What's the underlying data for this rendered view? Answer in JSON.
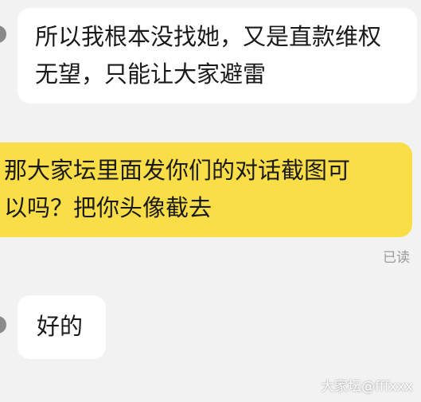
{
  "chat": {
    "messages": [
      {
        "direction": "incoming",
        "lines": [
          "所以我根本没找她，又是直款维权",
          "无望，只能让大家避雷"
        ]
      },
      {
        "direction": "outgoing",
        "lines": [
          "那大家坛里面发你们的对话截图可",
          "以吗？把你头像截去"
        ],
        "status": "已读"
      },
      {
        "direction": "incoming",
        "lines": [
          "好的"
        ]
      }
    ]
  },
  "watermark": "大家坛@fffxxx",
  "colors": {
    "background": "#f2f2f2",
    "incoming_bubble": "#ffffff",
    "outgoing_bubble": "#f9de48",
    "status_text": "#9b9b9b"
  }
}
